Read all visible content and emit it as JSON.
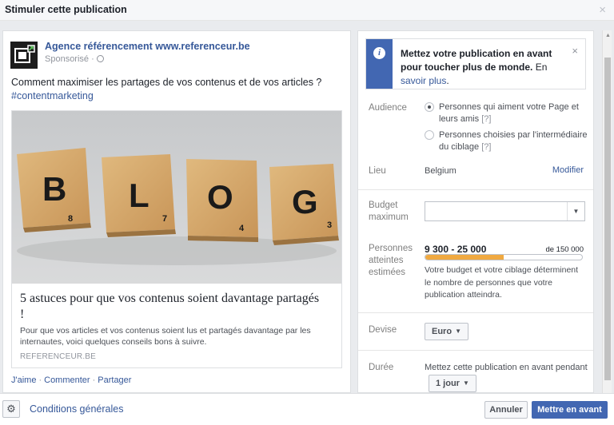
{
  "dialog": {
    "title": "Stimuler cette publication",
    "close_icon": "×"
  },
  "post": {
    "page_name": "Agence référencement www.referenceur.be",
    "sponsored": "Sponsorisé ·",
    "text": "Comment maximiser les partages de vos contenus et de vos articles ?",
    "hashtag": "#contentmarketing",
    "link": {
      "tiles": [
        {
          "letter": "B",
          "score": "8"
        },
        {
          "letter": "L",
          "score": "7"
        },
        {
          "letter": "O",
          "score": "4"
        },
        {
          "letter": "G",
          "score": "3"
        }
      ],
      "title": "5 astuces pour que vos contenus soient davantage partagés !",
      "description": "Pour que vos articles et vos contenus soient lus et partagés davantage par les internautes, voici quelques conseils bons à suivre.",
      "domain": "REFERENCEUR.BE"
    },
    "actions": [
      "J'aime",
      "Commenter",
      "Partager"
    ]
  },
  "panel": {
    "info": {
      "bold": "Mettez votre publication en avant pour toucher plus de monde.",
      "link_prefix": "En",
      "link": "savoir plus",
      "suffix": ".",
      "close_icon": "×"
    },
    "audience": {
      "label": "Audience",
      "options": [
        {
          "text": "Personnes qui aiment votre Page et leurs amis",
          "help": "[?]",
          "selected": true
        },
        {
          "text": "Personnes choisies par l'intermédiaire du ciblage",
          "help": "[?]",
          "selected": false
        }
      ]
    },
    "location": {
      "label": "Lieu",
      "value": "Belgium",
      "action": "Modifier"
    },
    "budget": {
      "label_line1": "Budget",
      "label_line2": "maximum",
      "value": ""
    },
    "reach": {
      "label_line1": "Personnes",
      "label_line2": "atteintes",
      "label_line3": "estimées",
      "range": "9 300 - 25 000",
      "max": "de 150 000",
      "fill_fraction": 0.5,
      "note": "Votre budget et votre ciblage déterminent le nombre de personnes que votre publication atteindra."
    },
    "currency": {
      "label": "Devise",
      "value": "Euro"
    },
    "duration": {
      "label": "Durée",
      "text": "Mettez cette publication en avant pendant",
      "value": "1 jour"
    }
  },
  "footer": {
    "terms": "Conditions générales",
    "cancel": "Annuler",
    "boost": "Mettre en avant"
  },
  "colors": {
    "accent": "#4267b2",
    "link": "#365899",
    "reach_fill": "#f0a940"
  }
}
